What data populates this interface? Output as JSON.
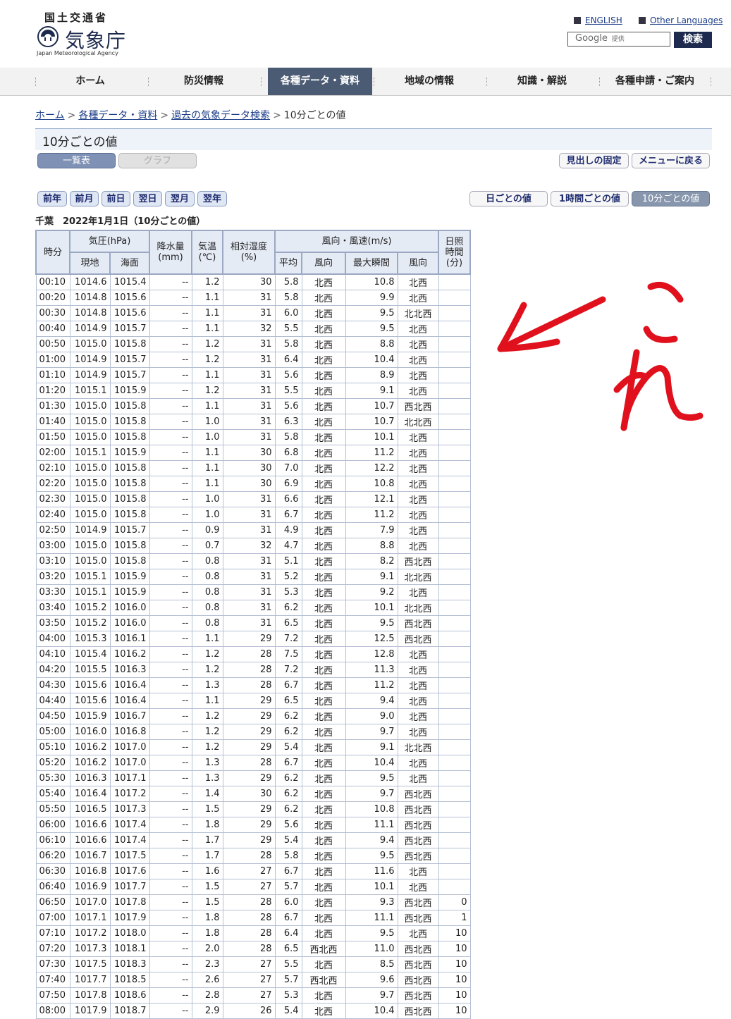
{
  "header": {
    "ministry": "国土交通省",
    "agency_name": "気象庁",
    "agency_en": "Japan Meteorological Agency",
    "english_link": "ENGLISH",
    "other_languages_link": "Other Languages",
    "search_brand": "Google",
    "search_provided": "提供",
    "search_button": "検索"
  },
  "nav": [
    "ホーム",
    "防災情報",
    "各種データ・資料",
    "地域の情報",
    "知識・解説",
    "各種申請・ご案内"
  ],
  "breadcrumb": [
    "ホーム",
    "各種データ・資料",
    "過去の気象データ検索",
    "10分ごとの値"
  ],
  "page_title": "10分ごとの値",
  "view_tabs": {
    "list": "一覧表",
    "graph": "グラフ"
  },
  "right_buttons": {
    "fix_header": "見出しの固定",
    "back_menu": "メニューに戻る"
  },
  "date_nav": [
    "前年",
    "前月",
    "前日",
    "翌日",
    "翌月",
    "翌年"
  ],
  "interval_buttons": [
    "日ごとの値",
    "1時間ごとの値",
    "10分ごとの値"
  ],
  "caption": "千葉　2022年1月1日（10分ごとの値）",
  "table_headers": {
    "time": "時分",
    "pressure": "気圧(hPa)",
    "pressure_local": "現地",
    "pressure_sea": "海面",
    "precip": "降水量",
    "precip_unit": "(mm)",
    "temp": "気温",
    "temp_unit": "(℃)",
    "humidity": "相対湿度",
    "humidity_unit": "(%)",
    "wind": "風向・風速(m/s)",
    "wind_avg": "平均",
    "wind_dir": "風向",
    "wind_gust": "最大瞬間",
    "wind_gust_dir": "風向",
    "sunshine_1": "日照",
    "sunshine_2": "時間",
    "sunshine_3": "(分)"
  },
  "rows": [
    [
      "00:10",
      "1014.6",
      "1015.4",
      "--",
      "1.2",
      "30",
      "5.8",
      "北西",
      "10.8",
      "北西",
      ""
    ],
    [
      "00:20",
      "1014.8",
      "1015.6",
      "--",
      "1.1",
      "31",
      "5.8",
      "北西",
      "9.9",
      "北西",
      ""
    ],
    [
      "00:30",
      "1014.8",
      "1015.6",
      "--",
      "1.1",
      "31",
      "6.0",
      "北西",
      "9.5",
      "北北西",
      ""
    ],
    [
      "00:40",
      "1014.9",
      "1015.7",
      "--",
      "1.1",
      "32",
      "5.5",
      "北西",
      "9.5",
      "北西",
      ""
    ],
    [
      "00:50",
      "1015.0",
      "1015.8",
      "--",
      "1.2",
      "31",
      "5.8",
      "北西",
      "8.8",
      "北西",
      ""
    ],
    [
      "01:00",
      "1014.9",
      "1015.7",
      "--",
      "1.2",
      "31",
      "6.4",
      "北西",
      "10.4",
      "北西",
      ""
    ],
    [
      "01:10",
      "1014.9",
      "1015.7",
      "--",
      "1.1",
      "31",
      "5.6",
      "北西",
      "8.9",
      "北西",
      ""
    ],
    [
      "01:20",
      "1015.1",
      "1015.9",
      "--",
      "1.2",
      "31",
      "5.5",
      "北西",
      "9.1",
      "北西",
      ""
    ],
    [
      "01:30",
      "1015.0",
      "1015.8",
      "--",
      "1.1",
      "31",
      "5.6",
      "北西",
      "10.7",
      "西北西",
      ""
    ],
    [
      "01:40",
      "1015.0",
      "1015.8",
      "--",
      "1.0",
      "31",
      "6.3",
      "北西",
      "10.7",
      "北北西",
      ""
    ],
    [
      "01:50",
      "1015.0",
      "1015.8",
      "--",
      "1.0",
      "31",
      "5.8",
      "北西",
      "10.1",
      "北西",
      ""
    ],
    [
      "02:00",
      "1015.1",
      "1015.9",
      "--",
      "1.1",
      "30",
      "6.8",
      "北西",
      "11.2",
      "北西",
      ""
    ],
    [
      "02:10",
      "1015.0",
      "1015.8",
      "--",
      "1.1",
      "30",
      "7.0",
      "北西",
      "12.2",
      "北西",
      ""
    ],
    [
      "02:20",
      "1015.0",
      "1015.8",
      "--",
      "1.1",
      "30",
      "6.9",
      "北西",
      "10.8",
      "北西",
      ""
    ],
    [
      "02:30",
      "1015.0",
      "1015.8",
      "--",
      "1.0",
      "31",
      "6.6",
      "北西",
      "12.1",
      "北西",
      ""
    ],
    [
      "02:40",
      "1015.0",
      "1015.8",
      "--",
      "1.0",
      "31",
      "6.7",
      "北西",
      "11.2",
      "北西",
      ""
    ],
    [
      "02:50",
      "1014.9",
      "1015.7",
      "--",
      "0.9",
      "31",
      "4.9",
      "北西",
      "7.9",
      "北西",
      ""
    ],
    [
      "03:00",
      "1015.0",
      "1015.8",
      "--",
      "0.7",
      "32",
      "4.7",
      "北西",
      "8.8",
      "北西",
      ""
    ],
    [
      "03:10",
      "1015.0",
      "1015.8",
      "--",
      "0.8",
      "31",
      "5.1",
      "北西",
      "8.2",
      "西北西",
      ""
    ],
    [
      "03:20",
      "1015.1",
      "1015.9",
      "--",
      "0.8",
      "31",
      "5.2",
      "北西",
      "9.1",
      "北北西",
      ""
    ],
    [
      "03:30",
      "1015.1",
      "1015.9",
      "--",
      "0.8",
      "31",
      "5.3",
      "北西",
      "9.2",
      "北西",
      ""
    ],
    [
      "03:40",
      "1015.2",
      "1016.0",
      "--",
      "0.8",
      "31",
      "6.2",
      "北西",
      "10.1",
      "北北西",
      ""
    ],
    [
      "03:50",
      "1015.2",
      "1016.0",
      "--",
      "0.8",
      "31",
      "6.5",
      "北西",
      "9.5",
      "西北西",
      ""
    ],
    [
      "04:00",
      "1015.3",
      "1016.1",
      "--",
      "1.1",
      "29",
      "7.2",
      "北西",
      "12.5",
      "西北西",
      ""
    ],
    [
      "04:10",
      "1015.4",
      "1016.2",
      "--",
      "1.2",
      "28",
      "7.5",
      "北西",
      "12.8",
      "北西",
      ""
    ],
    [
      "04:20",
      "1015.5",
      "1016.3",
      "--",
      "1.2",
      "28",
      "7.2",
      "北西",
      "11.3",
      "北西",
      ""
    ],
    [
      "04:30",
      "1015.6",
      "1016.4",
      "--",
      "1.3",
      "28",
      "6.7",
      "北西",
      "11.2",
      "北西",
      ""
    ],
    [
      "04:40",
      "1015.6",
      "1016.4",
      "--",
      "1.1",
      "29",
      "6.5",
      "北西",
      "9.4",
      "北西",
      ""
    ],
    [
      "04:50",
      "1015.9",
      "1016.7",
      "--",
      "1.2",
      "29",
      "6.2",
      "北西",
      "9.0",
      "北西",
      ""
    ],
    [
      "05:00",
      "1016.0",
      "1016.8",
      "--",
      "1.2",
      "29",
      "6.2",
      "北西",
      "9.7",
      "北西",
      ""
    ],
    [
      "05:10",
      "1016.2",
      "1017.0",
      "--",
      "1.2",
      "29",
      "5.4",
      "北西",
      "9.1",
      "北北西",
      ""
    ],
    [
      "05:20",
      "1016.2",
      "1017.0",
      "--",
      "1.3",
      "28",
      "6.7",
      "北西",
      "10.4",
      "北西",
      ""
    ],
    [
      "05:30",
      "1016.3",
      "1017.1",
      "--",
      "1.3",
      "29",
      "6.2",
      "北西",
      "9.5",
      "北西",
      ""
    ],
    [
      "05:40",
      "1016.4",
      "1017.2",
      "--",
      "1.4",
      "30",
      "6.2",
      "北西",
      "9.7",
      "西北西",
      ""
    ],
    [
      "05:50",
      "1016.5",
      "1017.3",
      "--",
      "1.5",
      "29",
      "6.2",
      "北西",
      "10.8",
      "西北西",
      ""
    ],
    [
      "06:00",
      "1016.6",
      "1017.4",
      "--",
      "1.8",
      "29",
      "5.6",
      "北西",
      "11.1",
      "西北西",
      ""
    ],
    [
      "06:10",
      "1016.6",
      "1017.4",
      "--",
      "1.7",
      "29",
      "5.4",
      "北西",
      "9.4",
      "西北西",
      ""
    ],
    [
      "06:20",
      "1016.7",
      "1017.5",
      "--",
      "1.7",
      "28",
      "5.8",
      "北西",
      "9.5",
      "西北西",
      ""
    ],
    [
      "06:30",
      "1016.8",
      "1017.6",
      "--",
      "1.6",
      "27",
      "6.7",
      "北西",
      "11.6",
      "北西",
      ""
    ],
    [
      "06:40",
      "1016.9",
      "1017.7",
      "--",
      "1.5",
      "27",
      "5.7",
      "北西",
      "10.1",
      "北西",
      ""
    ],
    [
      "06:50",
      "1017.0",
      "1017.8",
      "--",
      "1.5",
      "28",
      "6.0",
      "北西",
      "9.3",
      "西北西",
      "0"
    ],
    [
      "07:00",
      "1017.1",
      "1017.9",
      "--",
      "1.8",
      "28",
      "6.7",
      "北西",
      "11.1",
      "西北西",
      "1"
    ],
    [
      "07:10",
      "1017.2",
      "1018.0",
      "--",
      "1.8",
      "28",
      "6.4",
      "北西",
      "9.5",
      "北西",
      "10"
    ],
    [
      "07:20",
      "1017.3",
      "1018.1",
      "--",
      "2.0",
      "28",
      "6.5",
      "西北西",
      "11.0",
      "西北西",
      "10"
    ],
    [
      "07:30",
      "1017.5",
      "1018.3",
      "--",
      "2.3",
      "27",
      "5.5",
      "北西",
      "8.5",
      "西北西",
      "10"
    ],
    [
      "07:40",
      "1017.7",
      "1018.5",
      "--",
      "2.6",
      "27",
      "5.7",
      "西北西",
      "9.6",
      "西北西",
      "10"
    ],
    [
      "07:50",
      "1017.8",
      "1018.6",
      "--",
      "2.8",
      "27",
      "5.3",
      "北西",
      "9.7",
      "西北西",
      "10"
    ],
    [
      "08:00",
      "1017.9",
      "1018.7",
      "--",
      "2.9",
      "26",
      "5.4",
      "北西",
      "10.4",
      "西北西",
      "10"
    ]
  ],
  "annotation": {
    "text": "これ",
    "color": "#e0101c"
  },
  "colors": {
    "nav_active": "#4b5b74",
    "header_bg": "#e5ebf5",
    "annotation": "#e0101c"
  }
}
